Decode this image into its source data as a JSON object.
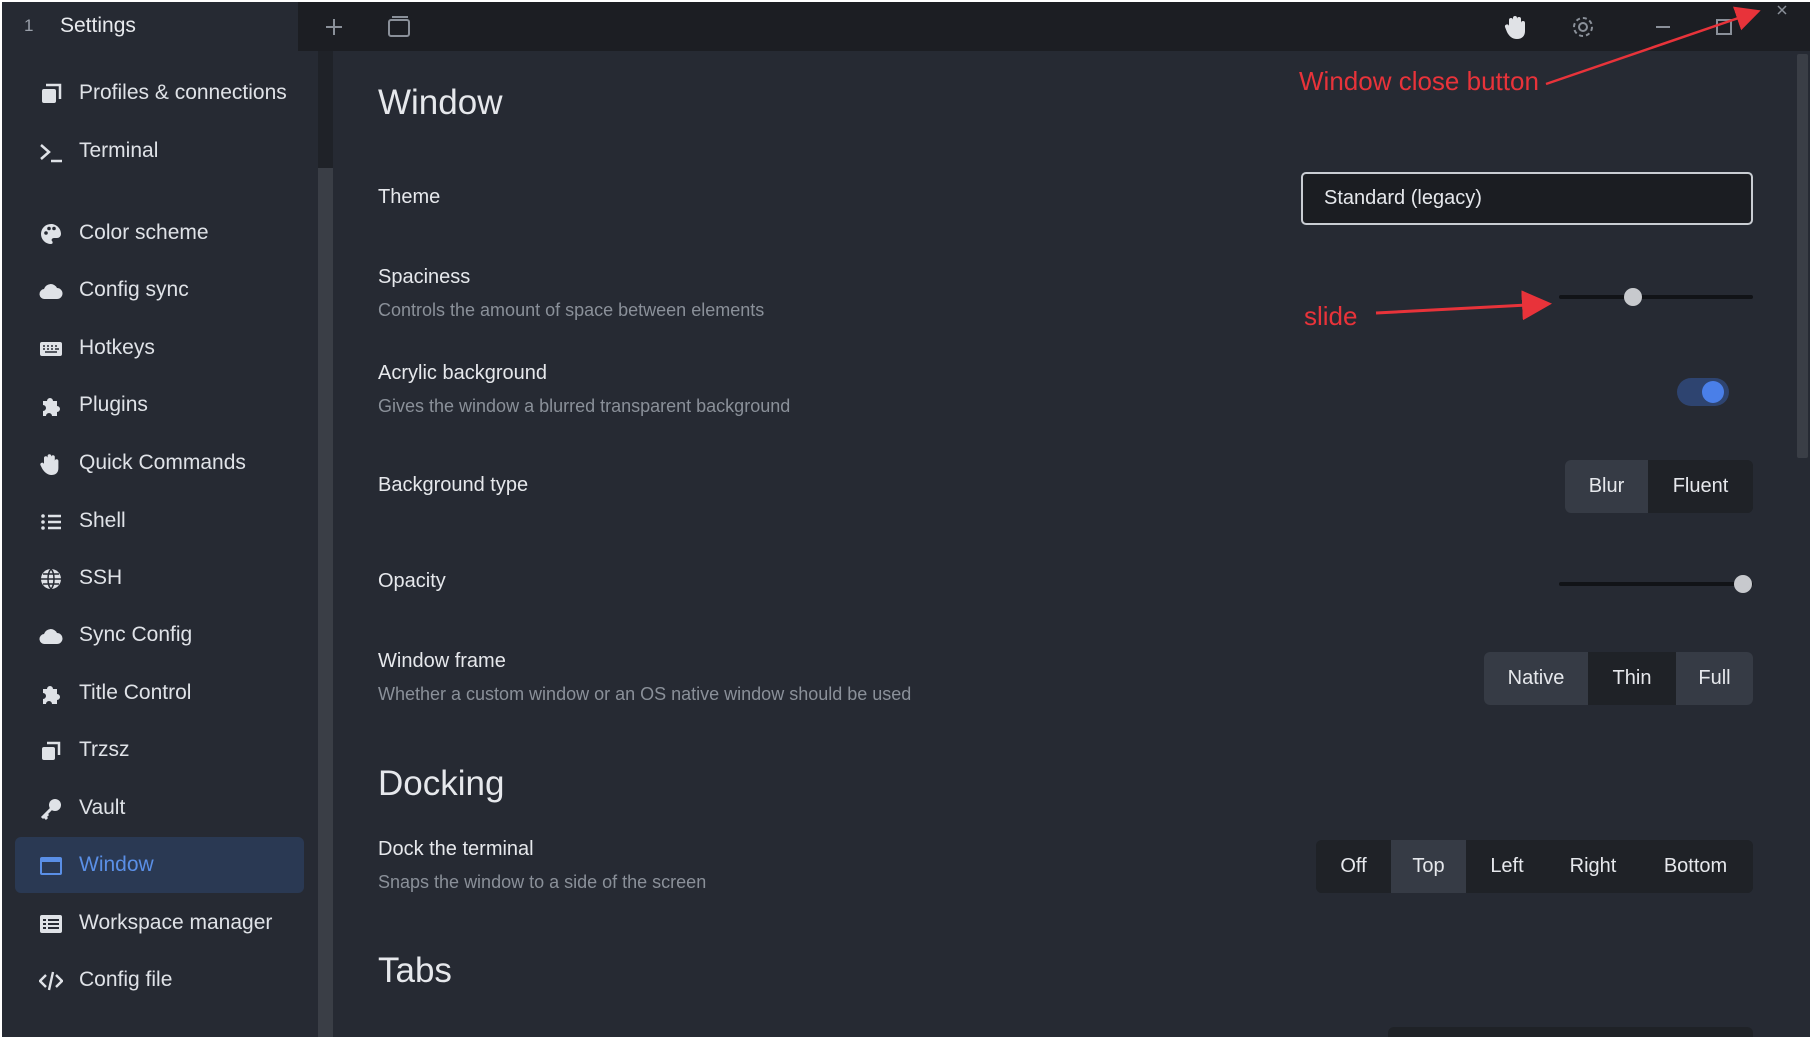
{
  "titlebar": {
    "tab_number": "1",
    "tab_title": "Settings",
    "new_tab_icon": "plus-icon",
    "window_icon": "window-icon",
    "hand_icon": "hand-icon",
    "settings_icon": "gear-icon",
    "minimize_icon": "minimize-icon",
    "maximize_icon": "maximize-icon",
    "close_icon": "close-icon"
  },
  "sidebar": {
    "items": [
      {
        "label": "Profiles & connections",
        "icon": "profiles-icon"
      },
      {
        "label": "Terminal",
        "icon": "terminal-icon"
      },
      {
        "label": "Color scheme",
        "icon": "palette-icon"
      },
      {
        "label": "Config sync",
        "icon": "cloud-icon"
      },
      {
        "label": "Hotkeys",
        "icon": "keyboard-icon"
      },
      {
        "label": "Plugins",
        "icon": "puzzle-icon"
      },
      {
        "label": "Quick Commands",
        "icon": "hand-icon"
      },
      {
        "label": "Shell",
        "icon": "list-icon"
      },
      {
        "label": "SSH",
        "icon": "globe-icon"
      },
      {
        "label": "Sync Config",
        "icon": "cloud-icon"
      },
      {
        "label": "Title Control",
        "icon": "puzzle-icon"
      },
      {
        "label": "Trzsz",
        "icon": "copy-icon"
      },
      {
        "label": "Vault",
        "icon": "key-icon"
      },
      {
        "label": "Window",
        "icon": "window-icon",
        "active": true
      },
      {
        "label": "Workspace manager",
        "icon": "workspace-icon"
      },
      {
        "label": "Config file",
        "icon": "code-icon"
      }
    ]
  },
  "main": {
    "window_heading": "Window",
    "theme": {
      "label": "Theme",
      "value": "Standard (legacy)"
    },
    "spaciness": {
      "label": "Spaciness",
      "description": "Controls the amount of space between elements",
      "value_fraction": 0.38
    },
    "acrylic": {
      "label": "Acrylic background",
      "description": "Gives the window a blurred transparent background",
      "enabled": true
    },
    "background_type": {
      "label": "Background type",
      "options": [
        "Blur",
        "Fluent"
      ],
      "selected": "Blur"
    },
    "opacity": {
      "label": "Opacity",
      "value_fraction": 0.95
    },
    "window_frame": {
      "label": "Window frame",
      "description": "Whether a custom window or an OS native window should be used",
      "options": [
        "Native",
        "Thin",
        "Full"
      ],
      "selected": [
        "Native",
        "Full"
      ]
    },
    "docking_heading": "Docking",
    "dock": {
      "label": "Dock the terminal",
      "description": "Snaps the window to a side of the screen",
      "options": [
        "Off",
        "Top",
        "Left",
        "Right",
        "Bottom"
      ],
      "selected": "Top"
    },
    "tabs_heading": "Tabs"
  },
  "annotations": {
    "close_button_note": "Window close button",
    "slide_note": "slide",
    "color": "#e8333a"
  },
  "colors": {
    "accent": "#4a7fe8",
    "active_item_bg": "#2a3953",
    "background": "#262a33",
    "titlebar": "#1c1e23"
  }
}
